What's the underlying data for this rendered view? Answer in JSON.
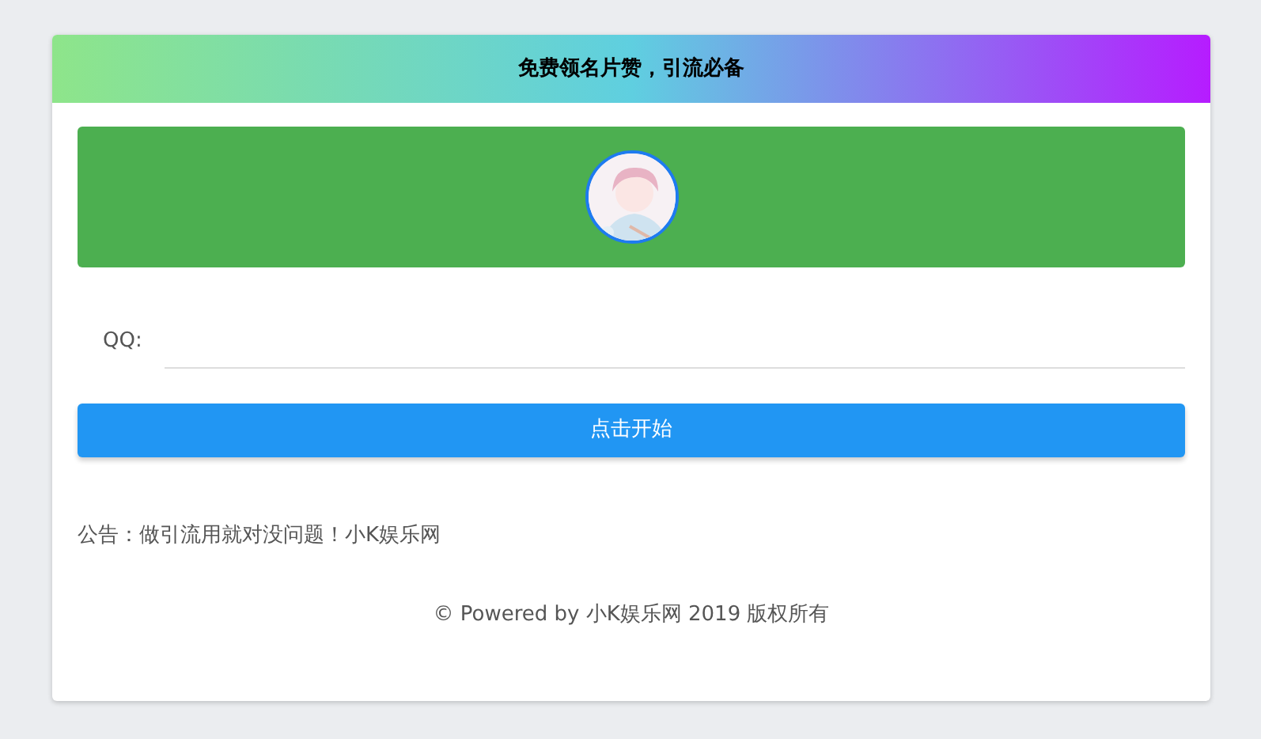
{
  "header": {
    "title": "免费领名片赞，引流必备"
  },
  "form": {
    "label": "QQ:"
  },
  "button": {
    "label": "点击开始"
  },
  "notice": "公告：做引流用就对没问题！小K娱乐网",
  "footer": "© Powered by 小K娱乐网 2019 版权所有"
}
